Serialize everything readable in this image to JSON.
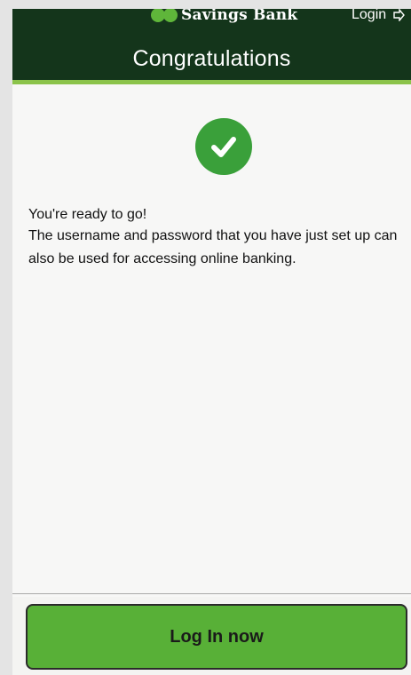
{
  "header": {
    "brand_name": "Savings Bank",
    "login_label": "Login",
    "title": "Congratulations"
  },
  "content": {
    "status_icon": "check-circle-icon",
    "ready_title": "You're ready to go!",
    "ready_message": "The username and password that you have just set up can also be used for accessing online banking."
  },
  "footer": {
    "login_button_label": "Log In now"
  },
  "colors": {
    "header_background": "#14351b",
    "accent": "#8bc34a",
    "success_green": "#3aa03a",
    "button_green": "#58b037"
  }
}
